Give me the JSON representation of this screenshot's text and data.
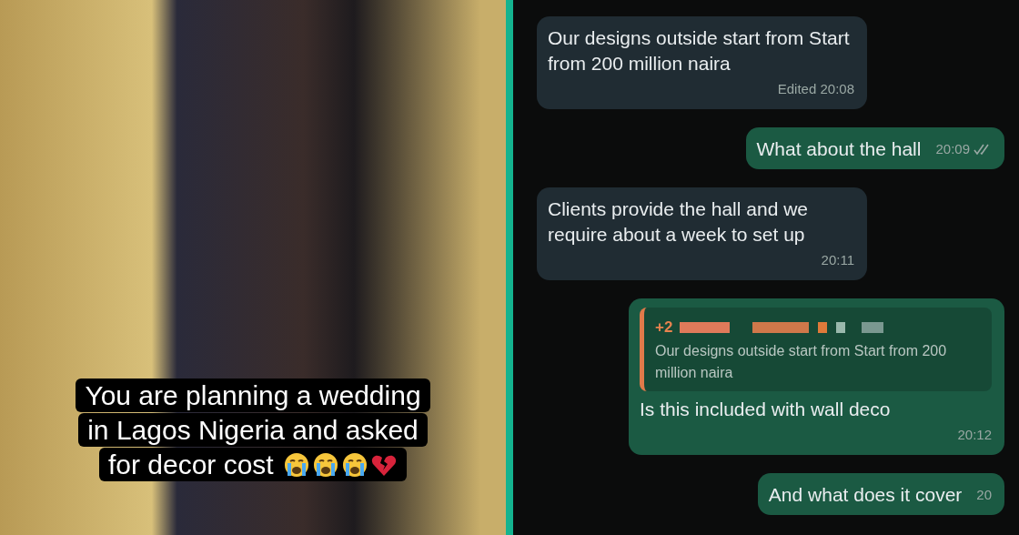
{
  "photo": {
    "caption_lines": [
      "You are planning a wedding",
      "in Lagos Nigeria and asked",
      "for decor cost"
    ],
    "caption_icons": [
      {
        "kind": "crying"
      },
      {
        "kind": "crying"
      },
      {
        "kind": "crying"
      },
      {
        "kind": "broken-heart"
      }
    ]
  },
  "chat": {
    "messages": [
      {
        "kind": "incoming",
        "text": "Our designs outside start from Start from 200 million naira",
        "time": "Edited 20:08"
      },
      {
        "kind": "outgoing",
        "text": "What about the hall",
        "time": "20:09",
        "ticks": true
      },
      {
        "kind": "incoming",
        "text": "Clients provide the hall and we require about a week to set up",
        "time": "20:11"
      },
      {
        "kind": "outgoing",
        "quote": {
          "sender": "+2",
          "text": "Our designs outside start from Start from 200 million naira"
        },
        "text": "Is this included with wall deco",
        "time": "20:12"
      },
      {
        "kind": "outgoing",
        "text": "And what does it cover",
        "time": "20"
      }
    ]
  }
}
